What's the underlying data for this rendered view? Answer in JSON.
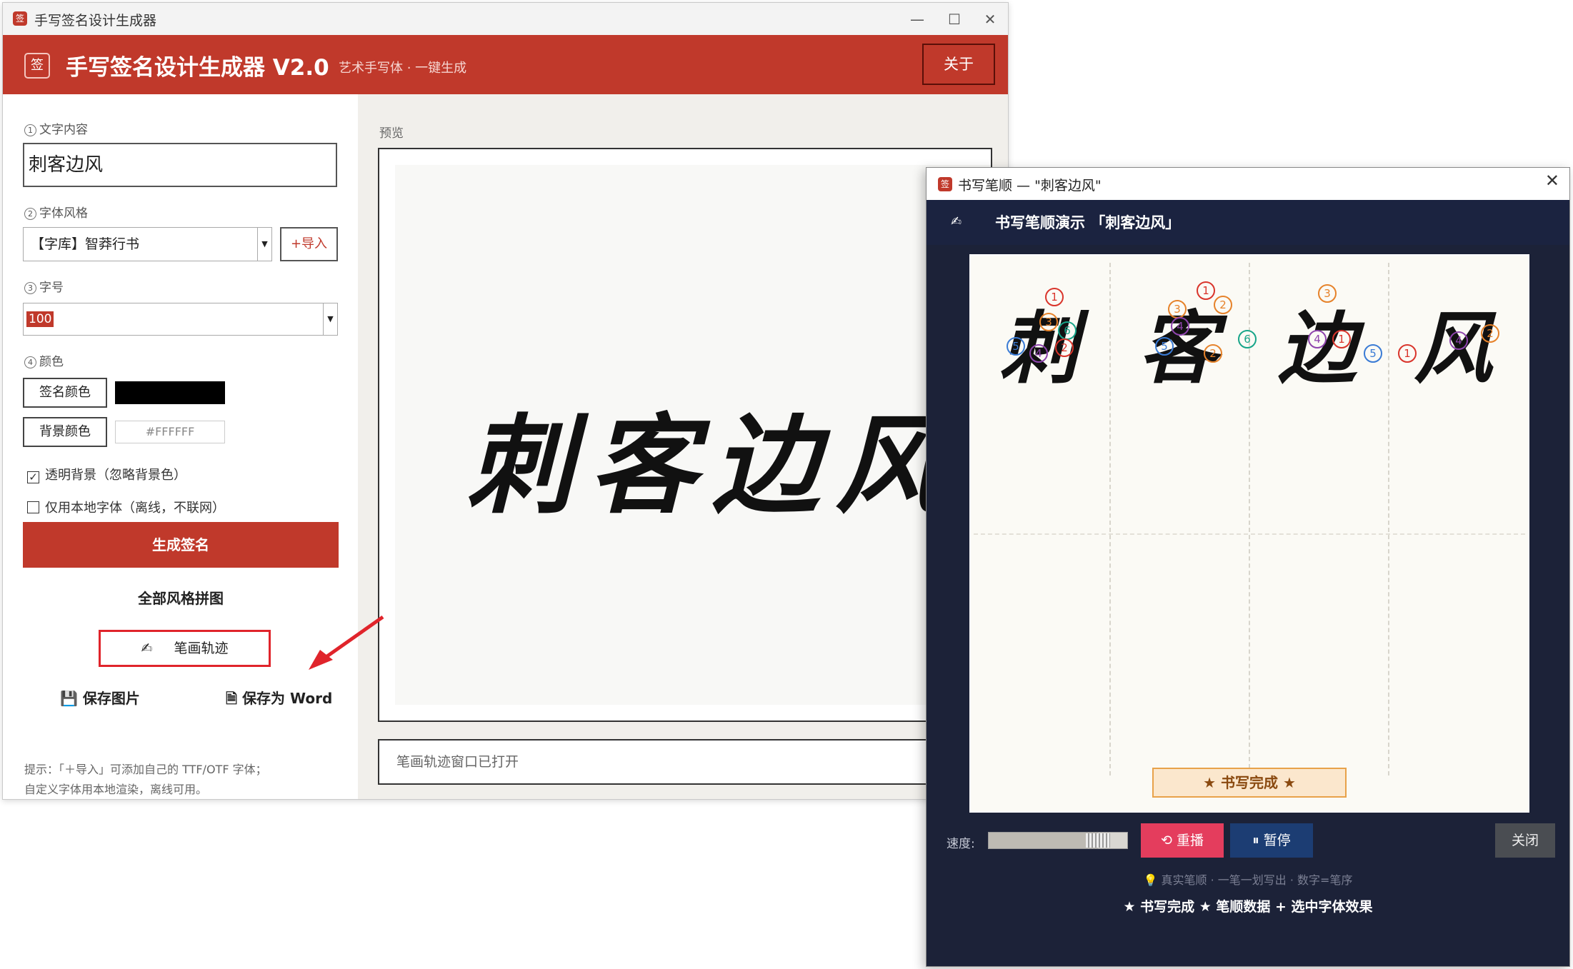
{
  "main_window": {
    "title": "手写签名设计生成器",
    "header": {
      "logo": "签",
      "title": "手写签名设计生成器 V2.0",
      "subtitle": "艺术手写体 · 一键生成",
      "about": "关于"
    },
    "form": {
      "text_label_num": "1",
      "text_label": "文字内容",
      "text_value": "刺客边风",
      "font_label_num": "2",
      "font_label": "字体风格",
      "font_value": "【字库】智莽行书",
      "import": "+导入",
      "size_label_num": "3",
      "size_label": "字号",
      "size_value": "100",
      "color_label_num": "4",
      "color_label": "颜色",
      "sig_color_btn": "签名颜色",
      "bg_color_btn": "背景颜色",
      "bg_color_value": "#FFFFFF",
      "transparent_bg": "透明背景（忽略背景色）",
      "local_font_only": "仅用本地字体（离线，不联网）",
      "generate": "生成签名",
      "mosaic": "全部风格拼图",
      "stroke": "笔画轨迹",
      "save_image": "保存图片",
      "save_word": "保存为 Word",
      "tip_line1": "提示：「＋导入」可添加自己的 TTF/OTF 字体；",
      "tip_line2": "自定义字体用本地渲染，离线可用。"
    },
    "preview": {
      "label": "预览",
      "signature": "刺客边风",
      "status": "笔画轨迹窗口已打开"
    }
  },
  "stroke_window": {
    "title": "书写笔顺 — \"刺客边风\"",
    "header": "书写笔顺演示 「刺客边风」",
    "characters": [
      "刺",
      "客",
      "边",
      "风"
    ],
    "done": "★ 书写完成 ★",
    "speed_label": "速度:",
    "speed_level": 0.85,
    "replay": "重播",
    "pause": "暂停",
    "close": "关闭",
    "hint": "真实笔顺 · 一笔一划写出 · 数字=笔序",
    "footer": "★ 书写完成 ★  笔顺数据 + 选中字体效果"
  },
  "colors": {
    "accent": "#c0392b",
    "stroke_header": "#1b2340",
    "signature_color": "#000000",
    "marker_red": "#d9342b",
    "marker_orange": "#e6822a",
    "marker_purple": "#8e44ad",
    "marker_blue": "#3a7bd5",
    "marker_teal": "#17a589"
  }
}
